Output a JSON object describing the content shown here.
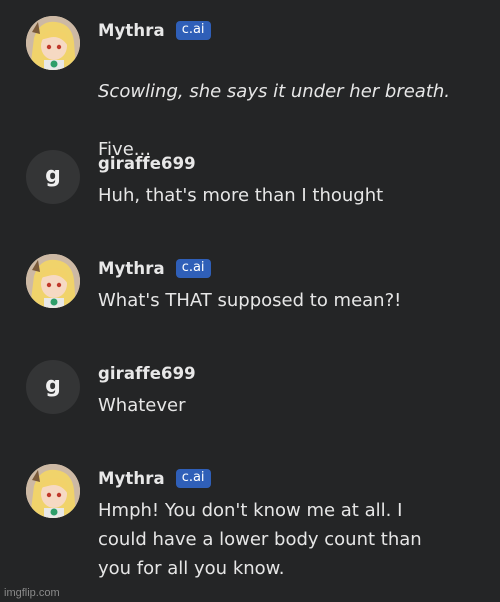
{
  "messages": [
    {
      "author": "Mythra",
      "badge": "c.ai",
      "action_line": "Scowling, she says it under her breath.",
      "text": "Five..."
    },
    {
      "author": "giraffe699",
      "avatar_letter": "g",
      "text": "Huh, that's more than I thought"
    },
    {
      "author": "Mythra",
      "badge": "c.ai",
      "text": "What's THAT supposed to mean?!"
    },
    {
      "author": "giraffe699",
      "avatar_letter": "g",
      "text": "Whatever"
    },
    {
      "author": "Mythra",
      "badge": "c.ai",
      "text": "Hmph! You don't know me at all. I\ncould have a lower body count than\nyou for all you know."
    }
  ],
  "watermark": "imgflip.com",
  "colors": {
    "background": "#242526",
    "badge": "#2f5fb8",
    "user_avatar": "#343536"
  }
}
